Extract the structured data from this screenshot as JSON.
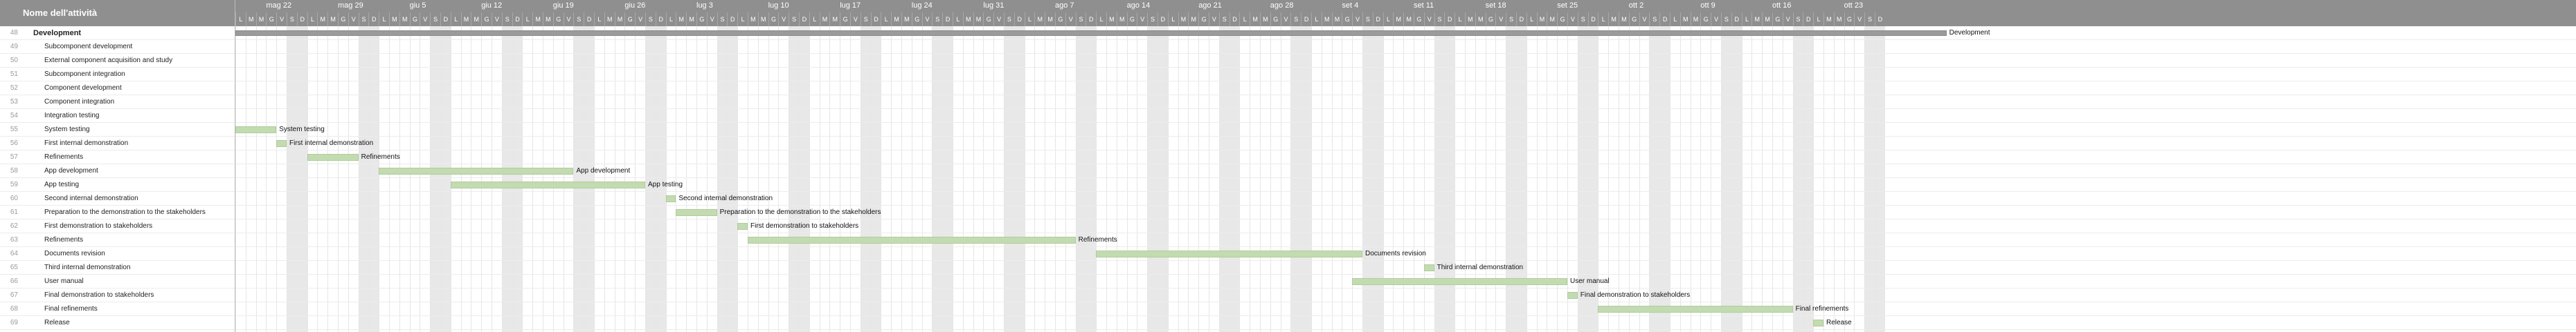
{
  "header": {
    "title": "Nome dell'attività"
  },
  "day_letters": [
    "L",
    "M",
    "M",
    "G",
    "V",
    "S",
    "D"
  ],
  "weeks": [
    "mag 22",
    "mag 29",
    "giu 5",
    "giu 12",
    "giu 19",
    "giu 26",
    "lug 3",
    "lug 10",
    "lug 17",
    "lug 24",
    "lug 31",
    "ago 7",
    "ago 14",
    "ago 21",
    "ago 28",
    "set 4",
    "set 11",
    "set 18",
    "set 25",
    "ott 2",
    "ott 9",
    "ott 16",
    "ott 23"
  ],
  "tasks": [
    {
      "num": "48",
      "name": "Development",
      "bold": true,
      "summary": true,
      "start": 0,
      "end": 167,
      "label": "Development"
    },
    {
      "num": "49",
      "name": "Subcomponent development",
      "start": null
    },
    {
      "num": "50",
      "name": "External component acquisition and study",
      "start": null
    },
    {
      "num": "51",
      "name": "Subcomponent integration",
      "start": null
    },
    {
      "num": "52",
      "name": "Component development",
      "start": null
    },
    {
      "num": "53",
      "name": "Component integration",
      "start": null
    },
    {
      "num": "54",
      "name": "Integration testing",
      "start": null
    },
    {
      "num": "55",
      "name": "System testing",
      "start": 0,
      "end": 4,
      "label": "System testing"
    },
    {
      "num": "56",
      "name": "First internal demonstration",
      "start": 4,
      "end": 5,
      "label": "First internal demonstration"
    },
    {
      "num": "57",
      "name": "Refinements",
      "start": 7,
      "end": 12,
      "label": "Refinements"
    },
    {
      "num": "58",
      "name": "App development",
      "start": 14,
      "end": 33,
      "label": "App development"
    },
    {
      "num": "59",
      "name": "App testing",
      "start": 21,
      "end": 40,
      "label": "App testing"
    },
    {
      "num": "60",
      "name": "Second internal demonstration",
      "start": 42,
      "end": 43,
      "label": "Second internal demonstration"
    },
    {
      "num": "61",
      "name": "Preparation to the demonstration to the stakeholders",
      "start": 43,
      "end": 47,
      "label": "Preparation to the demonstration to the stakeholders"
    },
    {
      "num": "62",
      "name": "First demonstration to stakeholders",
      "start": 49,
      "end": 50,
      "label": "First demonstration to stakeholders"
    },
    {
      "num": "63",
      "name": "Refinements",
      "start": 50,
      "end": 82,
      "label": "Refinements"
    },
    {
      "num": "64",
      "name": "Documents revision",
      "start": 84,
      "end": 110,
      "label": "Documents revision"
    },
    {
      "num": "65",
      "name": "Third internal demonstration",
      "start": 116,
      "end": 117,
      "label": "Third internal demonstration"
    },
    {
      "num": "66",
      "name": "User manual",
      "start": 109,
      "end": 130,
      "label": "User manual"
    },
    {
      "num": "67",
      "name": "Final demonstration to stakeholders",
      "start": 130,
      "end": 131,
      "label": "Final demonstration to stakeholders"
    },
    {
      "num": "68",
      "name": "Final refinements",
      "start": 133,
      "end": 152,
      "label": "Final refinements"
    },
    {
      "num": "69",
      "name": "Release",
      "start": 154,
      "end": 155,
      "label": "Release"
    }
  ],
  "colors": {
    "header": "#8f8f8f",
    "task_bar": "#c3dbb0",
    "summary_bar": "#9b9b9b",
    "weekend": "#e8e8e8"
  }
}
